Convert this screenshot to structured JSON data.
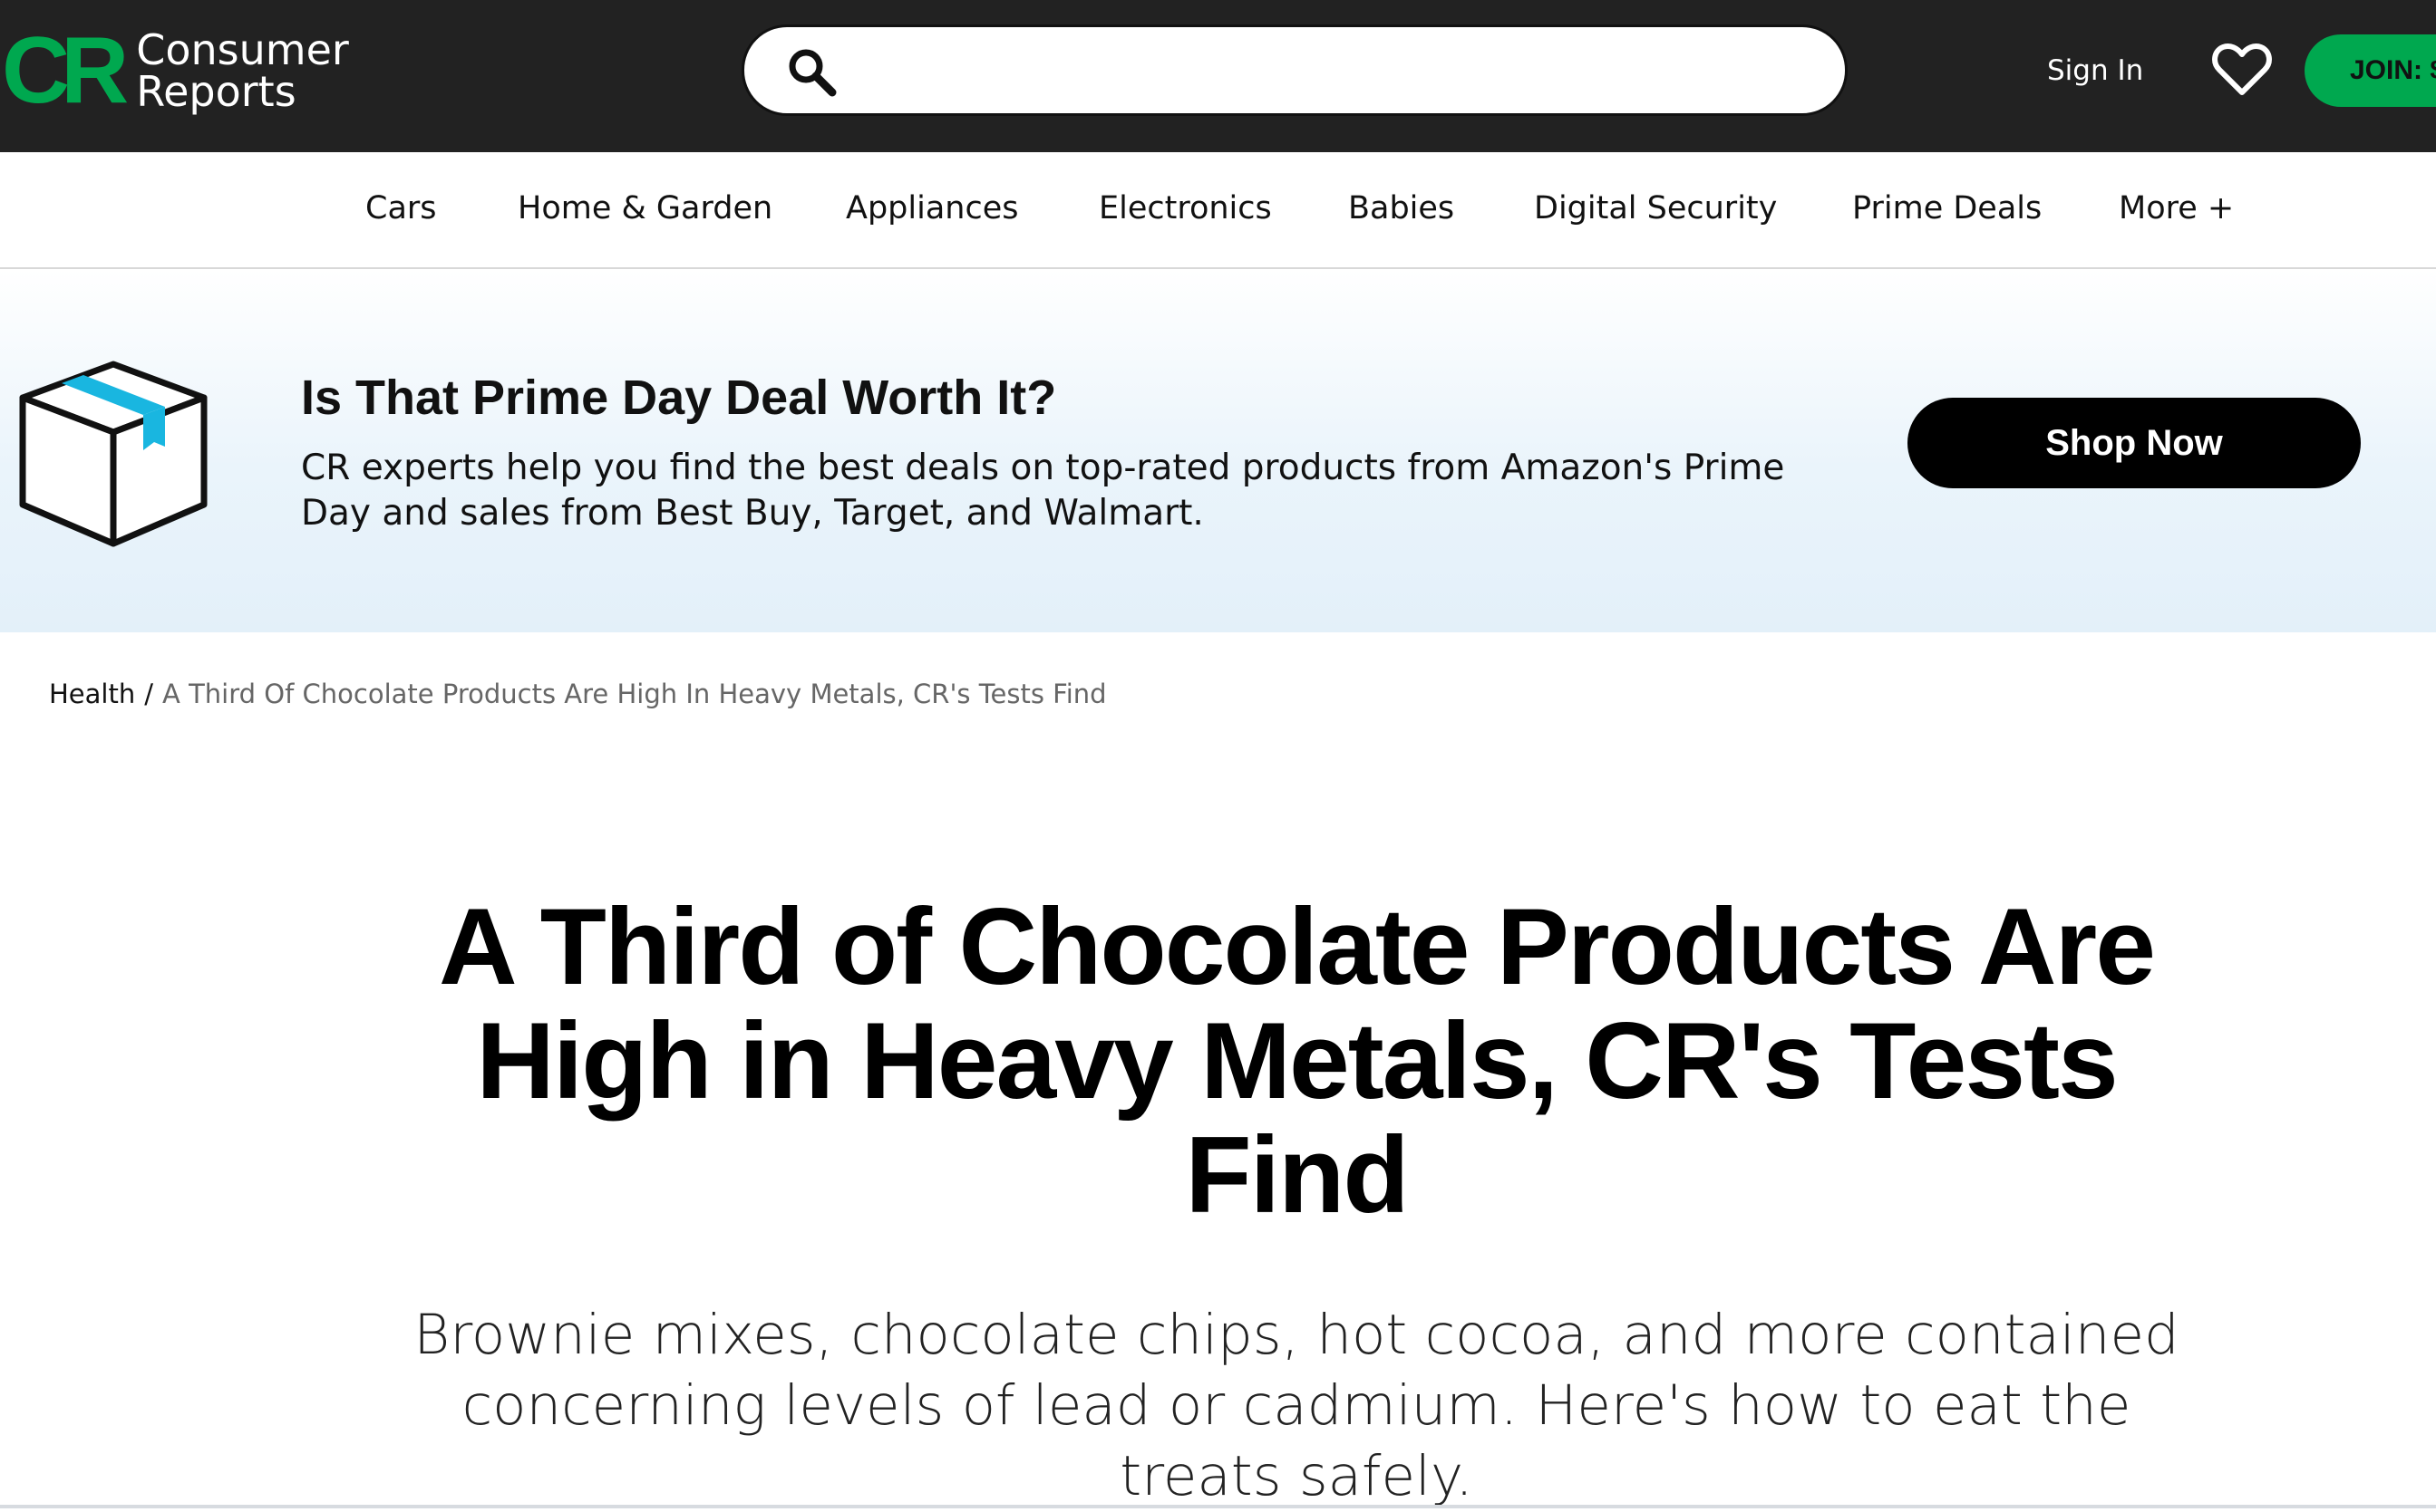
{
  "header": {
    "logo_mark": "CR",
    "logo_line1": "Consumer",
    "logo_line2": "Reports",
    "search_placeholder": "",
    "sign_in": "Sign In",
    "join_label": "JOIN: $",
    "accent_color": "#00a84f"
  },
  "nav": {
    "items": [
      {
        "label": "Cars"
      },
      {
        "label": "Home & Garden"
      },
      {
        "label": "Appliances"
      },
      {
        "label": "Electronics"
      },
      {
        "label": "Babies"
      },
      {
        "label": "Digital Security"
      },
      {
        "label": "Prime Deals"
      },
      {
        "label": "More +"
      }
    ]
  },
  "promo": {
    "title": "Is That Prime Day Deal Worth It?",
    "text": "CR experts help you find the best deals on top-rated products from Amazon's Prime Day and sales from Best Buy, Target, and Walmart.",
    "button": "Shop Now",
    "icon": "package-box-icon"
  },
  "breadcrumb": {
    "parent": "Health",
    "separator": "/",
    "current": "A Third Of Chocolate Products Are High In Heavy Metals, CR's Tests Find"
  },
  "article": {
    "headline": "A Third of Chocolate Products Are High in Heavy Metals, CR's Tests Find",
    "dek": "Brownie mixes, chocolate chips, hot cocoa, and more contained concerning levels of lead or cadmium. Here's how to eat the treats safely."
  }
}
